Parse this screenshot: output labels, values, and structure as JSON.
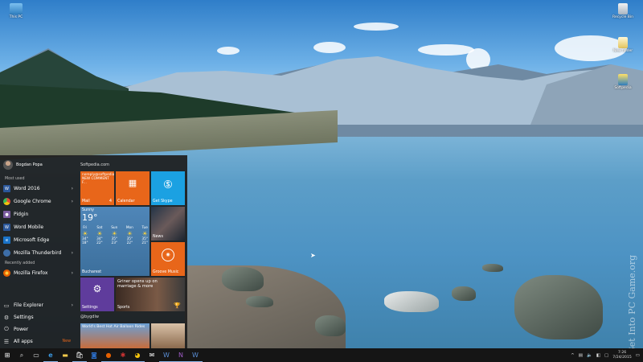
{
  "desktop": {
    "icons": [
      {
        "label": "This PC"
      },
      {
        "label": "Recycle Bin"
      },
      {
        "label": "New folder"
      },
      {
        "label": "Softpedia"
      }
    ],
    "watermark": "Get Into PC Game.org"
  },
  "start_menu": {
    "user_name": "Bogdan Popa",
    "most_used_label": "Most used",
    "most_used": [
      {
        "label": "Word 2016",
        "icon": "word-icon",
        "color": "#2b579a"
      },
      {
        "label": "Google Chrome",
        "icon": "chrome-icon",
        "color": "#dd4b39"
      },
      {
        "label": "Pidgin",
        "icon": "pidgin-icon",
        "color": "#7b5ca0"
      },
      {
        "label": "Word Mobile",
        "icon": "word-mobile-icon",
        "color": "#2b579a"
      },
      {
        "label": "Microsoft Edge",
        "icon": "edge-icon",
        "color": "#1a73c8"
      },
      {
        "label": "Mozilla Thunderbird",
        "icon": "thunderbird-icon",
        "color": "#3d6ea8"
      }
    ],
    "recently_added_label": "Recently added",
    "recently_added": [
      {
        "label": "Mozilla Firefox",
        "icon": "firefox-icon",
        "color": "#e66000"
      }
    ],
    "bottom": [
      {
        "label": "File Explorer",
        "icon": "folder-icon"
      },
      {
        "label": "Settings",
        "icon": "gear-icon"
      },
      {
        "label": "Power",
        "icon": "power-icon"
      },
      {
        "label": "All apps",
        "icon": "list-icon",
        "badge": "New"
      }
    ],
    "tiles": {
      "group1_label": "Softpedia.com",
      "mail": {
        "email": "noreply@softpedia.com",
        "preview": "NEW COMMENT F...",
        "label": "Mail",
        "count": "4",
        "color": "#e8661a"
      },
      "calendar": {
        "label": "Calendar",
        "color": "#e8661a"
      },
      "skype": {
        "label": "Get Skype",
        "color": "#1ba1e2"
      },
      "weather": {
        "condition": "Sunny",
        "temp": "19°",
        "days": [
          {
            "day": "Fri",
            "hi": "34°",
            "lo": "18°"
          },
          {
            "day": "Sat",
            "hi": "34°",
            "lo": "22°"
          },
          {
            "day": "Sun",
            "hi": "35°",
            "lo": "23°"
          },
          {
            "day": "Mon",
            "hi": "35°",
            "lo": "22°"
          },
          {
            "day": "Tue",
            "hi": "35°",
            "lo": "21°"
          }
        ],
        "city": "Bucharest"
      },
      "news": {
        "label": "News"
      },
      "groove": {
        "label": "Groove Music",
        "color": "#e8661a"
      },
      "settings": {
        "label": "Settings",
        "color": "#5f3c9c"
      },
      "sports": {
        "headline": "Griner opens up on marriage & more",
        "label": "Sports"
      },
      "group2_label": "@bygdlw",
      "balloon": {
        "headline": "World's Best Hot Air Balloon Rides"
      },
      "new_badge": "New"
    }
  },
  "taskbar": {
    "start": "start-icon",
    "apps": [
      "search-icon",
      "task-view-icon",
      "edge-icon",
      "file-explorer-icon",
      "store-icon",
      "outlook-icon",
      "firefox-icon",
      "pidgin-icon",
      "chrome-icon",
      "mail-icon",
      "word-icon",
      "onenote-icon",
      "word-mobile-icon"
    ],
    "time": "7:26",
    "date": "7/24/2015"
  }
}
